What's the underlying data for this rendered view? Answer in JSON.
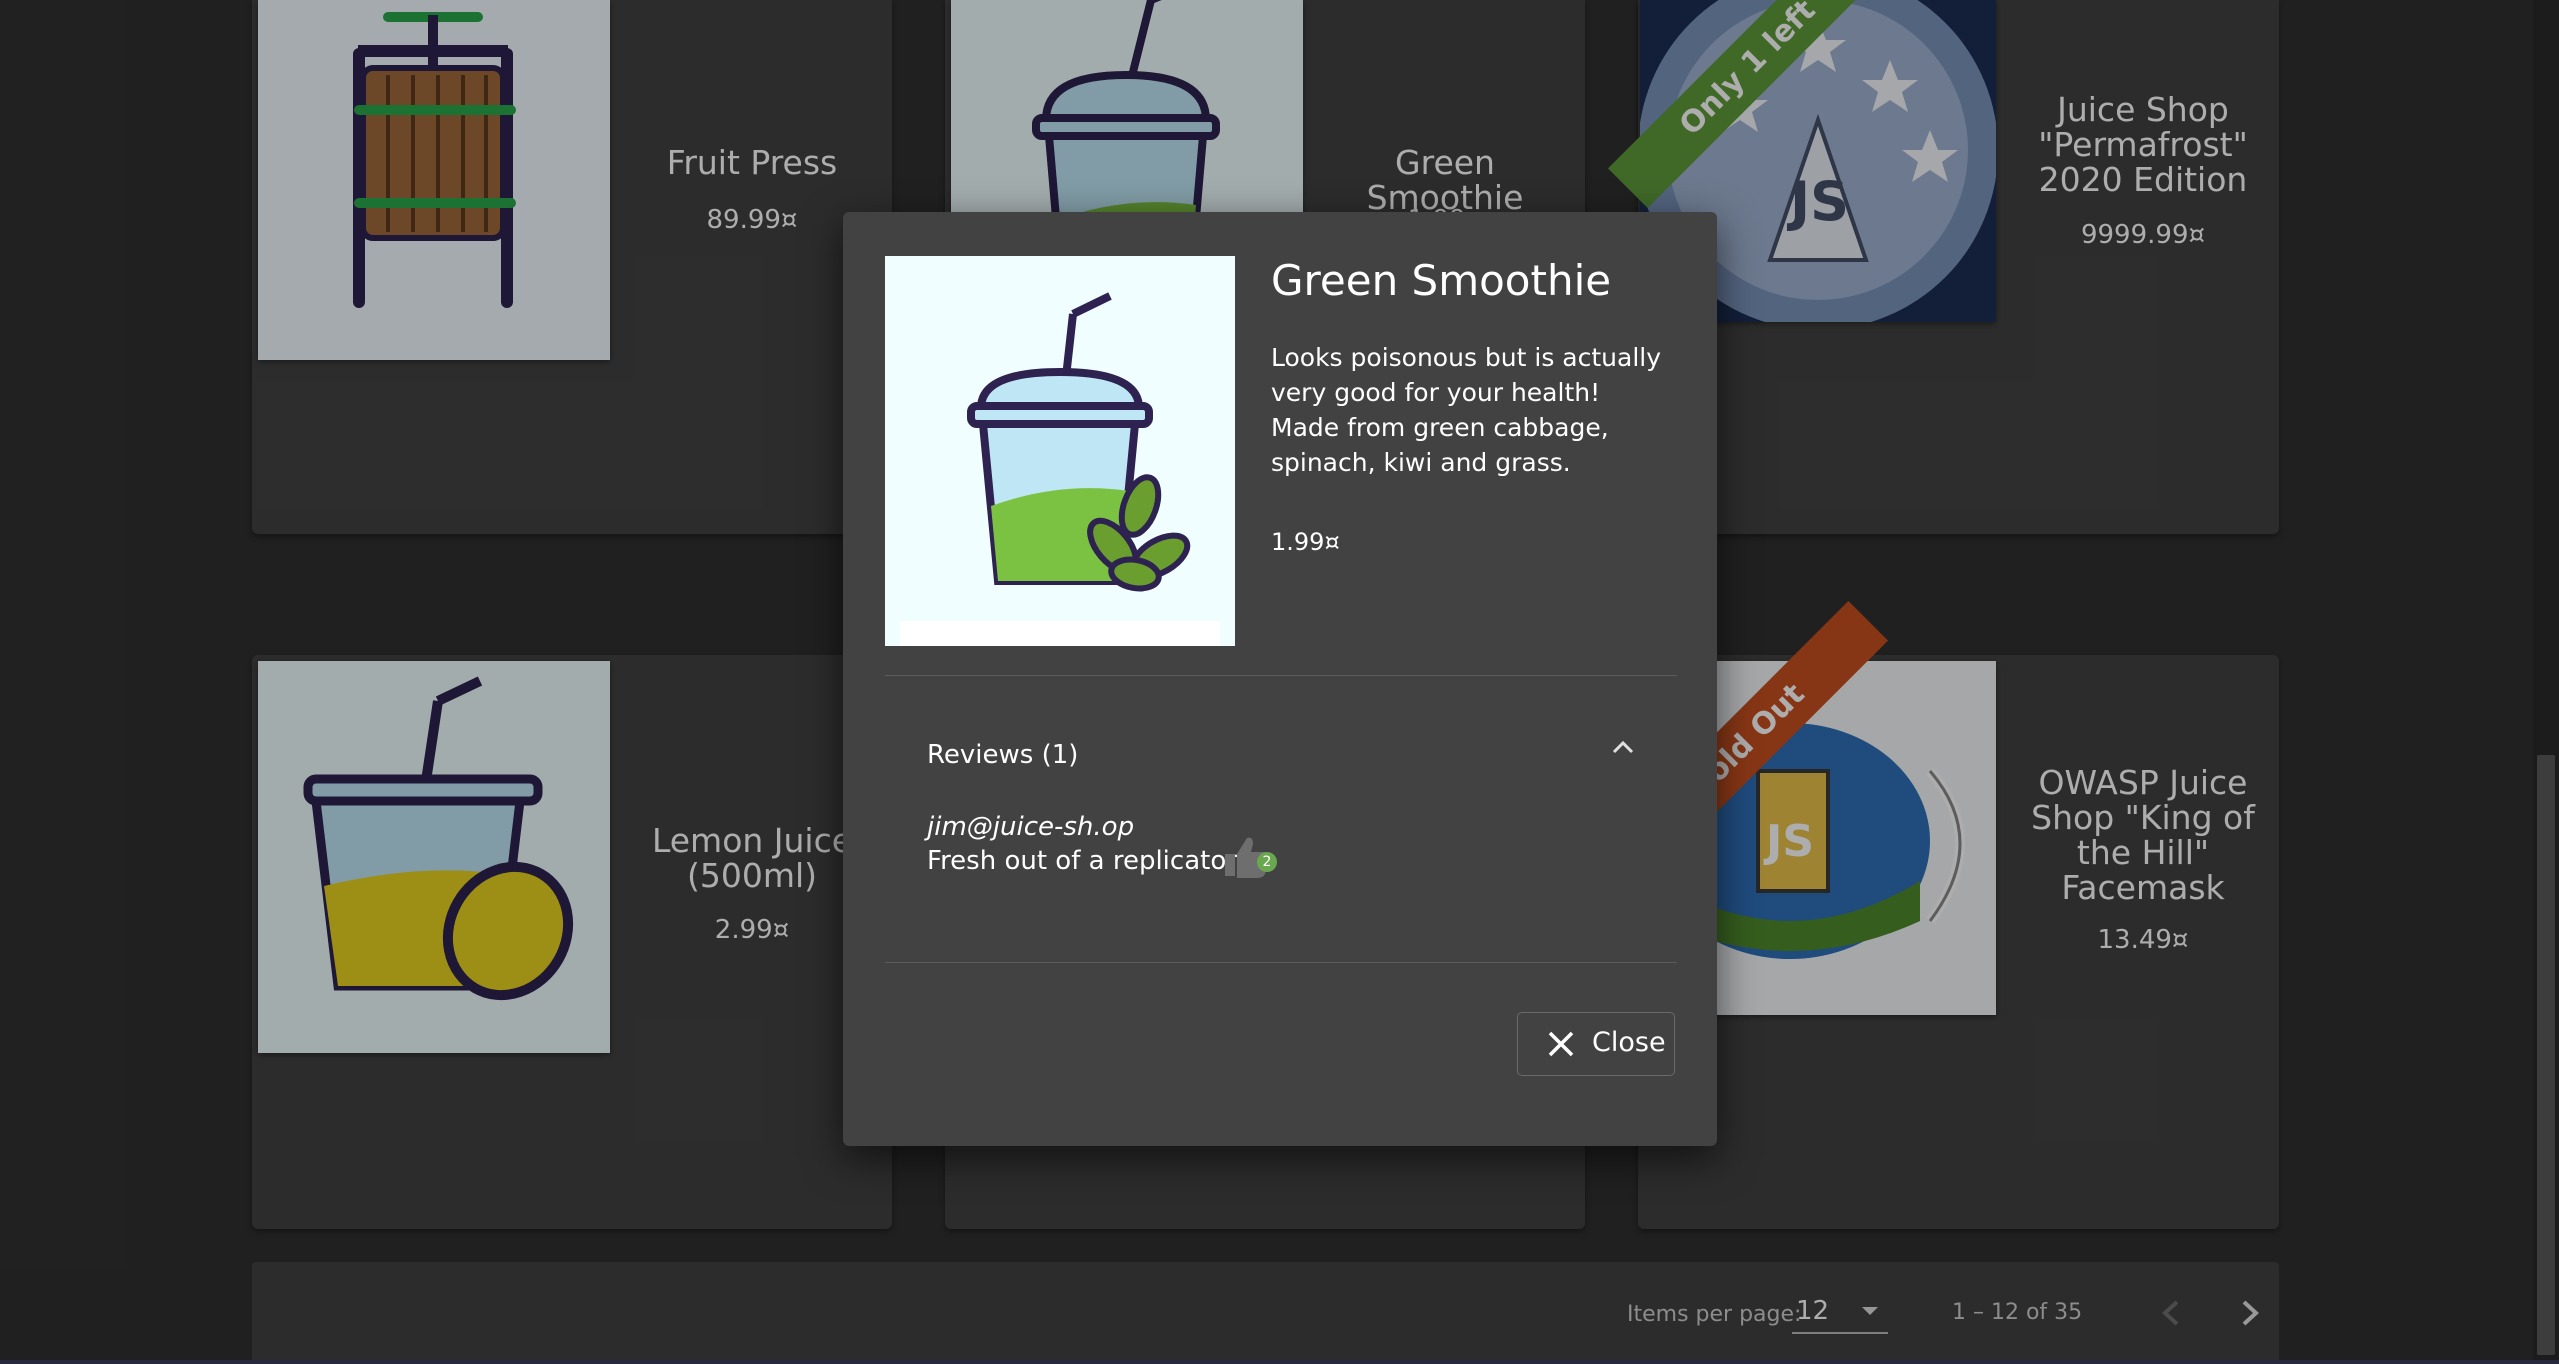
{
  "products": [
    {
      "name": "Fruit Press",
      "price": "89.99¤",
      "image": "fruit-press-icon"
    },
    {
      "name": "Green Smoothie",
      "price": "1.99¤",
      "image": "green-smoothie-icon"
    },
    {
      "name": "Juice Shop \"Permafrost\" 2020 Edition",
      "price": "9999.99¤",
      "image": "permafrost-coin-icon",
      "ribbon": "Only 1 left"
    },
    {
      "name": "Lemon Juice (500ml)",
      "price": "2.99¤",
      "image": "lemon-juice-icon"
    },
    {
      "name": "",
      "price": "",
      "image": ""
    },
    {
      "name": "OWASP Juice Shop \"King of the Hill\" Facemask",
      "price": "13.49¤",
      "image": "facemask-icon",
      "ribbon": "Sold Out"
    }
  ],
  "ribbons": {
    "only_left": "Only 1 left",
    "sold_out": "Sold Out"
  },
  "paginator": {
    "items_per_page_label": "Items per page:",
    "items_per_page_value": "12",
    "range_label": "1 – 12 of 35"
  },
  "dialog": {
    "title": "Green Smoothie",
    "description": "Looks poisonous but is actually very good for your health! Made from green cabbage, spinach, kiwi and grass.",
    "price": "1.99¤",
    "reviews_header": "Reviews (1)",
    "review": {
      "author": "jim@juice-sh.op",
      "text": "Fresh out of a replicator.",
      "likes": "2"
    },
    "close_label": "Close"
  },
  "colors": {
    "background": "#303030",
    "card": "#424242",
    "ribbon_green": "#5f9b3b",
    "ribbon_orange": "#c8501f",
    "like_badge": "#6aa84f"
  }
}
